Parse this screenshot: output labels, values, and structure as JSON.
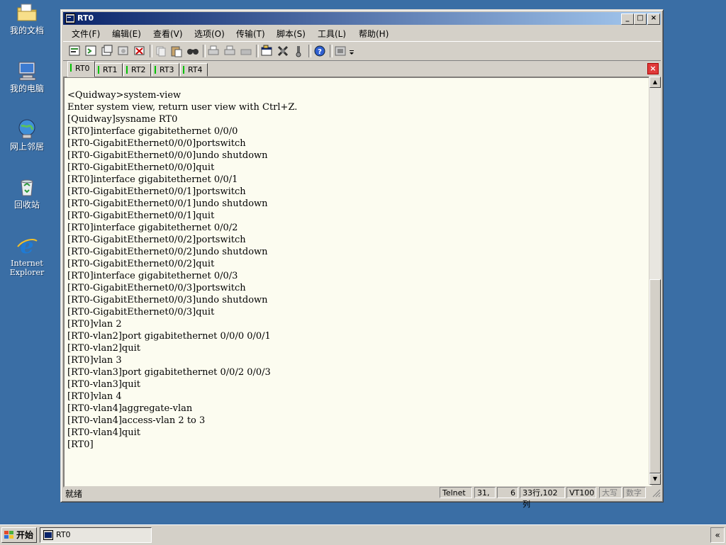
{
  "desktop": {
    "icons": [
      {
        "label": "我的文档",
        "icon": "folder-documents-icon"
      },
      {
        "label": "我的电脑",
        "icon": "computer-icon"
      },
      {
        "label": "网上邻居",
        "icon": "network-icon"
      },
      {
        "label": "回收站",
        "icon": "recycle-bin-icon"
      },
      {
        "label": "Internet Explorer",
        "icon": "internet-explorer-icon"
      }
    ]
  },
  "window": {
    "title": "RT0",
    "menu": [
      "文件(F)",
      "编辑(E)",
      "查看(V)",
      "选项(O)",
      "传输(T)",
      "脚本(S)",
      "工具(L)",
      "帮助(H)"
    ],
    "toolbar_icons": [
      "new-session-icon",
      "open-session-icon",
      "copy-session-icon",
      "connect-icon",
      "disconnect-icon",
      "copy-icon",
      "paste-icon",
      "find-icon",
      "print-icon",
      "print-setup-icon",
      "print-preview-icon",
      "session-options-icon",
      "global-options-icon",
      "keymap-icon",
      "help-icon",
      "settings-icon"
    ],
    "tabs": [
      "RT0",
      "RT1",
      "RT2",
      "RT3",
      "RT4"
    ],
    "active_tab": "RT0",
    "terminal_lines": [
      "<Quidway>system-view",
      "Enter system view, return user view with Ctrl+Z.",
      "[Quidway]sysname RT0",
      "[RT0]interface gigabitethernet 0/0/0",
      "[RT0-GigabitEthernet0/0/0]portswitch",
      "[RT0-GigabitEthernet0/0/0]undo shutdown",
      "[RT0-GigabitEthernet0/0/0]quit",
      "[RT0]interface gigabitethernet 0/0/1",
      "[RT0-GigabitEthernet0/0/1]portswitch",
      "[RT0-GigabitEthernet0/0/1]undo shutdown",
      "[RT0-GigabitEthernet0/0/1]quit",
      "[RT0]interface gigabitethernet 0/0/2",
      "[RT0-GigabitEthernet0/0/2]portswitch",
      "[RT0-GigabitEthernet0/0/2]undo shutdown",
      "[RT0-GigabitEthernet0/0/2]quit",
      "[RT0]interface gigabitethernet 0/0/3",
      "[RT0-GigabitEthernet0/0/3]portswitch",
      "[RT0-GigabitEthernet0/0/3]undo shutdown",
      "[RT0-GigabitEthernet0/0/3]quit",
      "[RT0]vlan 2",
      "[RT0-vlan2]port gigabitethernet 0/0/0 0/0/1",
      "[RT0-vlan2]quit",
      "[RT0]vlan 3",
      "[RT0-vlan3]port gigabitethernet 0/0/2 0/0/3",
      "[RT0-vlan3]quit",
      "[RT0]vlan 4",
      "[RT0-vlan4]aggregate-vlan",
      "[RT0-vlan4]access-vlan 2 to 3",
      "[RT0-vlan4]quit",
      "[RT0]"
    ],
    "status": {
      "ready": "就绪",
      "protocol": "Telnet",
      "row": "31,",
      "col": "6",
      "size": "33行,102列",
      "emulation": "VT100",
      "caps": "大写",
      "num": "数字"
    }
  },
  "taskbar": {
    "start_label": "开始",
    "task_label": "RT0",
    "tray_label": "«"
  }
}
